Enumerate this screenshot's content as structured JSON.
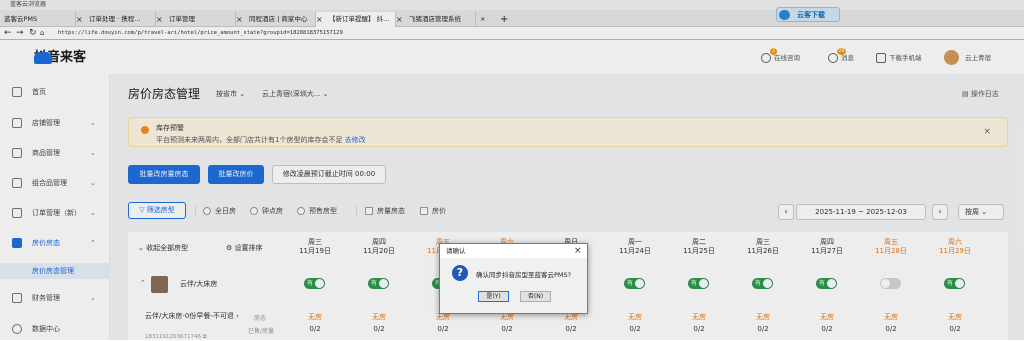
{
  "browser": {
    "title": "蓝客云浏览器",
    "tabs": [
      {
        "label": "蓝客云PMS",
        "active": false
      },
      {
        "label": "订单处理 · 携程...",
        "active": false
      },
      {
        "label": "订单管理",
        "active": false
      },
      {
        "label": "同程酒店 | 商家中心",
        "active": false
      },
      {
        "label": "【新订单提醒】 抖...",
        "active": true
      },
      {
        "label": "飞猪酒店管理系统",
        "active": false
      }
    ],
    "new_tab_icon": "+",
    "url": "https://life.douyin.com/p/travel-ari/hotel/price_amount_state?groupid=1828818375157129",
    "cloud_button": "云客下载"
  },
  "header": {
    "logo_text": "抖音来客",
    "support": "在线咨询",
    "support_badge": "2",
    "messages": "消息",
    "messages_badge": "26",
    "download_app": "下载手机端",
    "user_name": "云上青宿"
  },
  "sidebar": {
    "items": [
      {
        "label": "首页",
        "icon": "home-icon",
        "chevron": ""
      },
      {
        "label": "店铺管理",
        "icon": "shop-icon",
        "chevron": "⌄"
      },
      {
        "label": "商品管理",
        "icon": "goods-icon",
        "chevron": "⌄"
      },
      {
        "label": "组合品管理",
        "icon": "combo-icon",
        "chevron": "⌄"
      },
      {
        "label": "订单管理（新）",
        "icon": "order-icon",
        "chevron": "⌄"
      },
      {
        "label": "房价房态",
        "icon": "bed-icon",
        "chevron": "⌃"
      },
      {
        "label": "房价房态管理",
        "icon": "",
        "chevron": ""
      },
      {
        "label": "财务管理",
        "icon": "finance-icon",
        "chevron": "⌄"
      },
      {
        "label": "数据中心",
        "icon": "data-icon",
        "chevron": ""
      }
    ]
  },
  "page": {
    "title": "房价房态管理",
    "city_dropdown": "按省市 ⌄",
    "store_dropdown": "云上青宿(深圳大... ⌄",
    "op_log": "操作日志"
  },
  "warning": {
    "title": "库存预警",
    "text": "平台预测未来两周内，全部门店共计有1个房型的库存会不足",
    "link": "去修改"
  },
  "actions": {
    "batch_status": "批量改房量房态",
    "batch_price": "批量改房价",
    "modify_cutoff": "修改凌晨预订截止时间 00:00"
  },
  "filters": {
    "filter_rooms": "筛选房型",
    "all_day": "全日房",
    "hourly": "钟点房",
    "pre_sale": "预售房型",
    "room_status": "房量房态",
    "room_price": "房价",
    "date_range": "2025-11-19 ~ 2025-12-03",
    "week": "按周 ⌄"
  },
  "grid": {
    "collapse_all": "收起全部房型",
    "settings_sort": "设置排序",
    "days": [
      {
        "weekday": "周三",
        "date": "11月19日",
        "weekend": false
      },
      {
        "weekday": "周四",
        "date": "11月20日",
        "weekend": false
      },
      {
        "weekday": "周五",
        "date": "11月21日",
        "weekend": true
      },
      {
        "weekday": "周六",
        "date": "11月22日",
        "weekend": true
      },
      {
        "weekday": "周日",
        "date": "11月23日",
        "weekend": false
      },
      {
        "weekday": "周一",
        "date": "11月24日",
        "weekend": false
      },
      {
        "weekday": "周二",
        "date": "11月25日",
        "weekend": false
      },
      {
        "weekday": "周三",
        "date": "11月26日",
        "weekend": false
      },
      {
        "weekday": "周四",
        "date": "11月27日",
        "weekend": false
      },
      {
        "weekday": "周五",
        "date": "11月28日",
        "weekend": true
      },
      {
        "weekday": "周六",
        "date": "11月29日",
        "weekend": true
      }
    ],
    "room": {
      "name": "云伴/大床房",
      "toggles": [
        "有",
        "有",
        "有",
        "有",
        "有",
        "有",
        "有",
        "有",
        "有",
        "",
        "有"
      ],
      "toggle_on_label": "有",
      "product": "云伴/大床房-0份早餐-不可退 ›",
      "product_id": "1831191203671746 ⧉",
      "row_price_label": "房态",
      "row_sold_label": "已售/房量",
      "status": "无房",
      "sold": "0/2"
    }
  },
  "dialog": {
    "title": "请确认",
    "message": "确认同步抖音房型至蓝客云PMS?",
    "yes": "是(Y)",
    "no": "否(N)"
  }
}
